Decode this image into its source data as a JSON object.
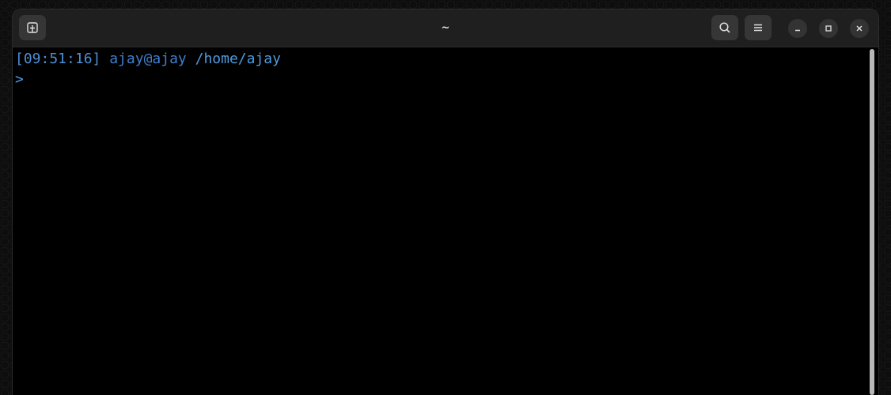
{
  "window": {
    "title": "~"
  },
  "titlebar": {
    "buttons": [
      {
        "name": "new-tab",
        "icon": "new-tab-icon"
      },
      {
        "name": "search",
        "icon": "search-icon"
      },
      {
        "name": "menu",
        "icon": "hamburger-menu-icon"
      },
      {
        "name": "minimize",
        "icon": "minimize-icon"
      },
      {
        "name": "maximize",
        "icon": "maximize-icon"
      },
      {
        "name": "close",
        "icon": "close-icon"
      }
    ]
  },
  "terminal": {
    "prompt_time": "[09:51:16]",
    "prompt_user": "ajay@ajay",
    "prompt_path": "/home/ajay",
    "prompt_symbol": ">"
  },
  "colors": {
    "titlebar_bg": "#1f1f1f",
    "terminal_bg": "#000000",
    "prompt_blue": "#4d8fd6",
    "title_text": "#e6e6e6"
  }
}
